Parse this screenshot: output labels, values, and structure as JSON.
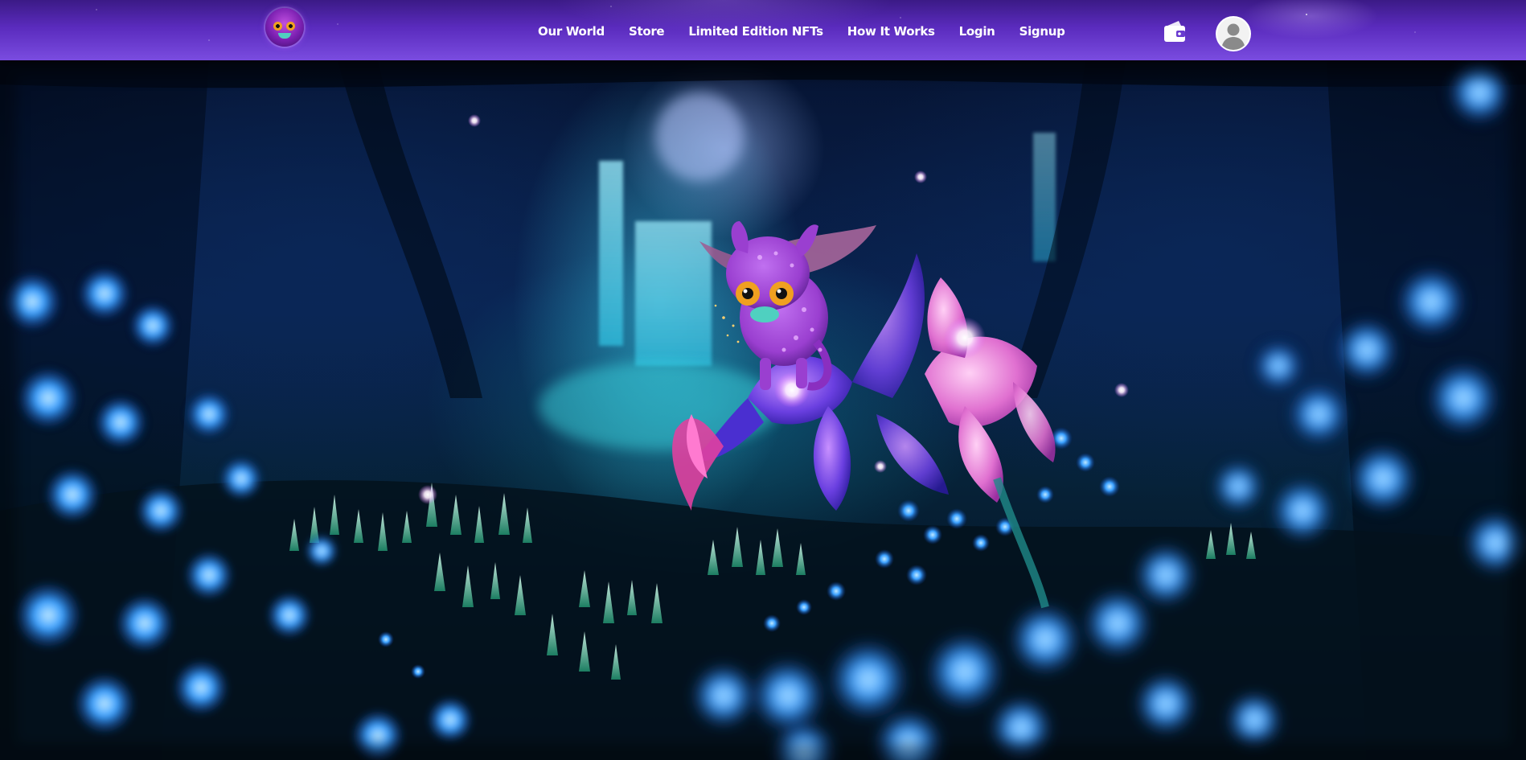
{
  "nav": {
    "logo_icon": "creature-logo-icon",
    "links": [
      {
        "label": "Our World"
      },
      {
        "label": "Store"
      },
      {
        "label": "Limited Edition NFTs"
      },
      {
        "label": "How It Works"
      },
      {
        "label": "Login"
      },
      {
        "label": "Signup"
      }
    ],
    "wallet_icon": "wallet-icon",
    "avatar_icon": "user-avatar-icon"
  },
  "hero": {
    "scene": "glowing-forest-illustration",
    "colors": {
      "nav_top": "#3b1a86",
      "nav_bottom": "#7a4ce0",
      "glow_blue": "#3aa0ff",
      "glow_cyan": "#5ff0d0",
      "orchid_pink": "#e070d0",
      "creature_purple": "#9a3fd0"
    }
  }
}
